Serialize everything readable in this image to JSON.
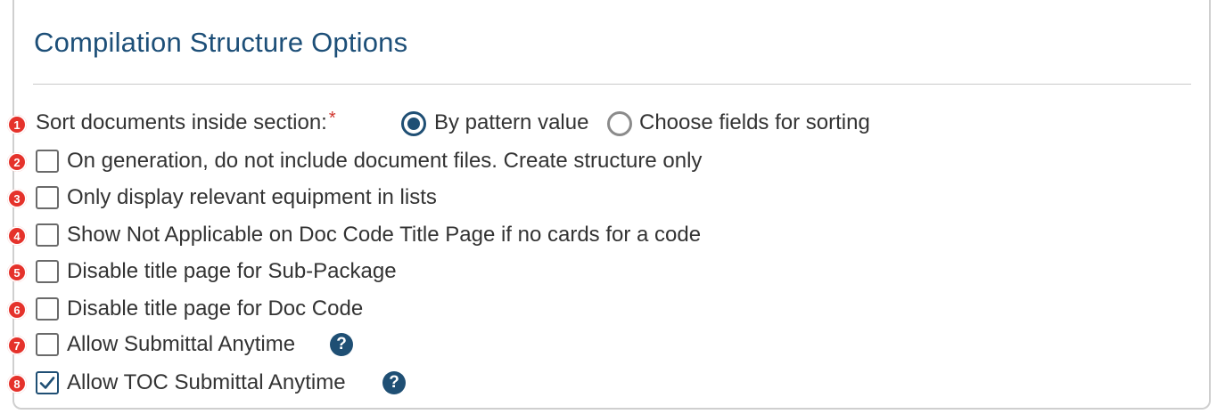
{
  "section": {
    "title": "Compilation Structure Options"
  },
  "sort": {
    "marker": "1",
    "label": "Sort documents inside section:",
    "required_mark": "*",
    "options": [
      {
        "label": "By pattern value",
        "selected": true
      },
      {
        "label": "Choose fields for sorting",
        "selected": false
      }
    ]
  },
  "options": [
    {
      "marker": "2",
      "label": "On generation, do not include document files. Create structure only",
      "checked": false
    },
    {
      "marker": "3",
      "label": "Only display relevant equipment in lists",
      "checked": false
    },
    {
      "marker": "4",
      "label": "Show Not Applicable on Doc Code Title Page if no cards for a code",
      "checked": false
    },
    {
      "marker": "5",
      "label": "Disable title page for Sub-Package",
      "checked": false
    },
    {
      "marker": "6",
      "label": "Disable title page for Doc Code",
      "checked": false
    },
    {
      "marker": "7",
      "label": "Allow Submittal Anytime",
      "checked": false,
      "help": "?"
    },
    {
      "marker": "8",
      "label": "Allow TOC Submittal Anytime",
      "checked": true,
      "help": "?"
    }
  ],
  "colors": {
    "accent": "#1f4f74",
    "title": "#1d4f78",
    "marker": "#e5322b",
    "required": "#d0342c"
  },
  "icons": {
    "help": "question-circle-icon",
    "check": "checkmark-icon"
  }
}
